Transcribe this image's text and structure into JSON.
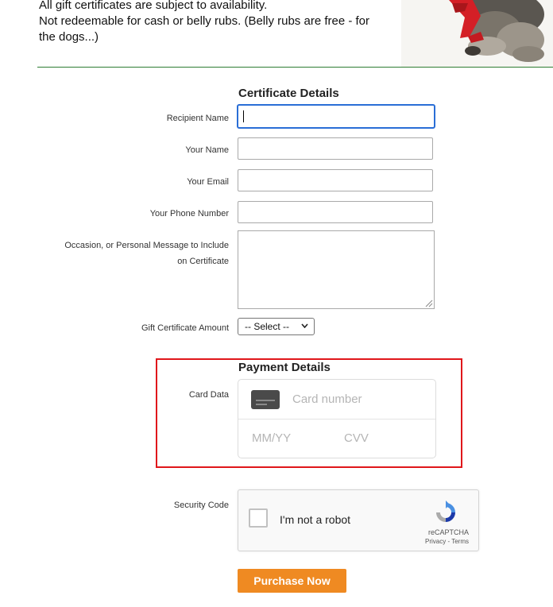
{
  "intro": {
    "line1": "All gift certificates are subject to availability.",
    "line2": "Not redeemable for cash or belly rubs. (Belly rubs are free - for",
    "line3": "the dogs...)"
  },
  "certificate_details": {
    "title": "Certificate Details",
    "fields": {
      "recipient_name": {
        "label": "Recipient Name",
        "value": ""
      },
      "your_name": {
        "label": "Your Name",
        "value": ""
      },
      "your_email": {
        "label": "Your Email",
        "value": ""
      },
      "phone": {
        "label": "Your Phone Number",
        "value": ""
      },
      "message": {
        "label_line1": "Occasion, or Personal Message to Include",
        "label_line2": "on Certificate",
        "value": ""
      },
      "amount": {
        "label": "Gift Certificate Amount",
        "selected": "-- Select --"
      }
    }
  },
  "payment_details": {
    "title": "Payment Details",
    "card_label": "Card Data",
    "card_number_placeholder": "Card number",
    "expiry_placeholder": "MM/YY",
    "cvv_placeholder": "CVV",
    "highlight_color": "#e0171b"
  },
  "security": {
    "label": "Security Code",
    "captcha_text": "I'm not a robot",
    "captcha_brand": "reCAPTCHA",
    "captcha_links": "Privacy - Terms"
  },
  "purchase_button": {
    "label": "Purchase Now",
    "color": "#ef8a22"
  },
  "colors": {
    "divider": "#2e7d32",
    "focus": "#2a6ed6"
  },
  "icons": [
    "dog-photo",
    "card-icon",
    "recaptcha-logo-icon",
    "chevron-down-icon",
    "resize-grip-icon"
  ]
}
